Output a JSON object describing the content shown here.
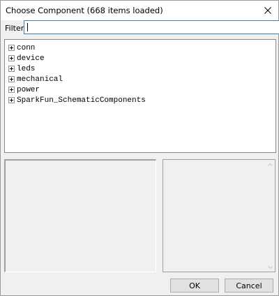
{
  "window": {
    "title": "Choose Component (668 items loaded)"
  },
  "filter": {
    "label": "Filter:",
    "value": "",
    "placeholder": ""
  },
  "tree": {
    "items": [
      {
        "label": "conn",
        "expander": "plus-icon"
      },
      {
        "label": "device",
        "expander": "plus-icon"
      },
      {
        "label": "leds",
        "expander": "plus-icon"
      },
      {
        "label": "mechanical",
        "expander": "plus-icon"
      },
      {
        "label": "power",
        "expander": "plus-icon"
      },
      {
        "label": "SparkFun_SchematicComponents",
        "expander": "plus-icon"
      }
    ]
  },
  "buttons": {
    "ok_label": "OK",
    "cancel_label": "Cancel"
  },
  "colors": {
    "input_focus_border": "#3c7fb1",
    "dialog_background": "#f0f0f0"
  }
}
